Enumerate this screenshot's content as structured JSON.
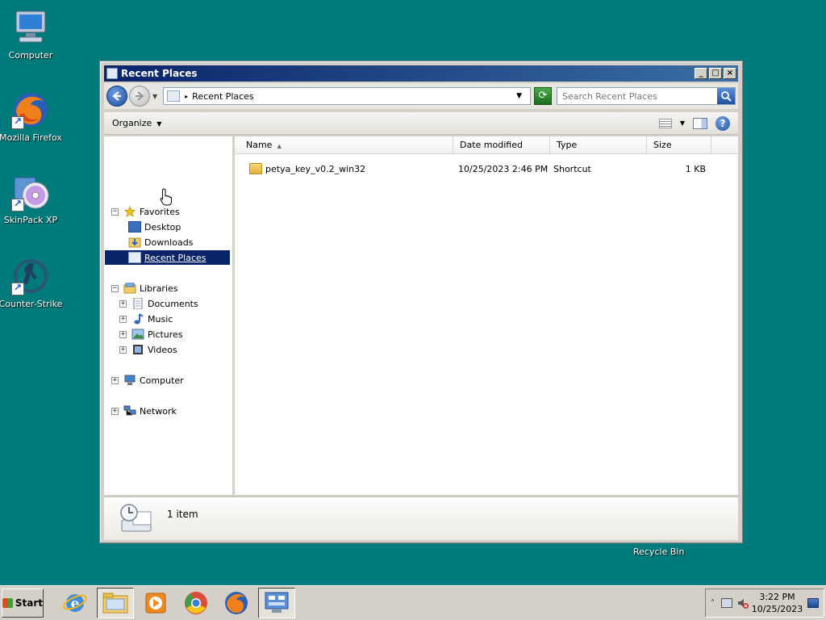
{
  "desktop": {
    "icons": [
      {
        "label": "Computer"
      },
      {
        "label": "Mozilla Firefox"
      },
      {
        "label": "SkinPack XP"
      },
      {
        "label": "Counter-Strike"
      }
    ],
    "recycle_bin_label": "Recycle Bin"
  },
  "window": {
    "title": "Recent Places",
    "controls": {
      "minimize": "_",
      "maximize": "□",
      "close": "×"
    },
    "address": {
      "location": "Recent Places"
    },
    "search": {
      "placeholder": "Search Recent Places"
    },
    "commandbar": {
      "organize_label": "Organize"
    },
    "nav": {
      "favorites": {
        "label": "Favorites",
        "items": [
          "Desktop",
          "Downloads",
          "Recent Places"
        ]
      },
      "libraries": {
        "label": "Libraries",
        "items": [
          "Documents",
          "Music",
          "Pictures",
          "Videos"
        ]
      },
      "computer": "Computer",
      "network": "Network",
      "toggle_expanded": "−",
      "toggle_collapsed": "+"
    },
    "columns": [
      "Name",
      "Date modified",
      "Type",
      "Size"
    ],
    "files": [
      {
        "name": "petya_key_v0.2_win32",
        "date": "10/25/2023 2:46 PM",
        "type": "Shortcut",
        "size": "1 KB"
      }
    ],
    "details": {
      "count": "1 item"
    }
  },
  "taskbar": {
    "start_label": "Start",
    "clock": {
      "time": "3:22 PM",
      "date": "10/25/2023"
    },
    "tray_arrow": "˄"
  },
  "colors": {
    "desktop": "#007a7a",
    "titlebar": "#0a246a",
    "selection": "#0a246a"
  }
}
